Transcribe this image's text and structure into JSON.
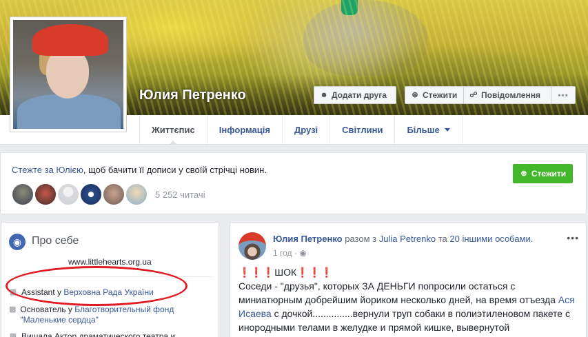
{
  "profile": {
    "name": "Юлия Петренко"
  },
  "cover_actions": {
    "add_friend": "Додати друга",
    "follow": "Стежити",
    "message": "Повідомлення",
    "more": "•••"
  },
  "tabs": [
    {
      "label": "Життєпис"
    },
    {
      "label": "Інформація"
    },
    {
      "label": "Друзі"
    },
    {
      "label": "Світлини"
    },
    {
      "label": "Більше"
    }
  ],
  "follow_box": {
    "link_text": "Стежте за Юлією",
    "text_after": ", щоб бачити її дописи у своїй стрічці новин.",
    "button_label": "Стежити",
    "readers": "5 252 читачі"
  },
  "about": {
    "title": "Про себе",
    "website": "www.littlehearts.org.ua",
    "work_prefix": "Assistant у",
    "work_link": "Верховна Рада України",
    "founder_prefix": "Основатель у",
    "founder_link": "Благотворительный фонд \"Маленькие сердца\"",
    "actress_text": "Вишала Актор драматического театра и"
  },
  "post": {
    "author": "Юлия Петренко",
    "with_text": "разом з",
    "tagged": "Julia Petrenko",
    "and_text": "та",
    "others": "20 іншими особами.",
    "time": "1 год",
    "dots": "•••",
    "headline_marks": "❗❗❗",
    "headline_word": "ШОК",
    "headline_marks_after": "❗❗❗",
    "body_1": "Соседи - \"друзья\", которых ЗА ДЕНЬГИ попросили остаться с миниатюрным добрейшим йориком несколько дней, на время отъезда ",
    "body_link": "Ася Исаева",
    "body_2": " с дочкой...............вернули труп собаки в полиэтиленовом пакете с инородными телами в желудке и прямой кишке, вывернутой"
  },
  "colors": {
    "link": "#365899",
    "green": "#42b72a",
    "annotation_red": "#e01b24"
  }
}
